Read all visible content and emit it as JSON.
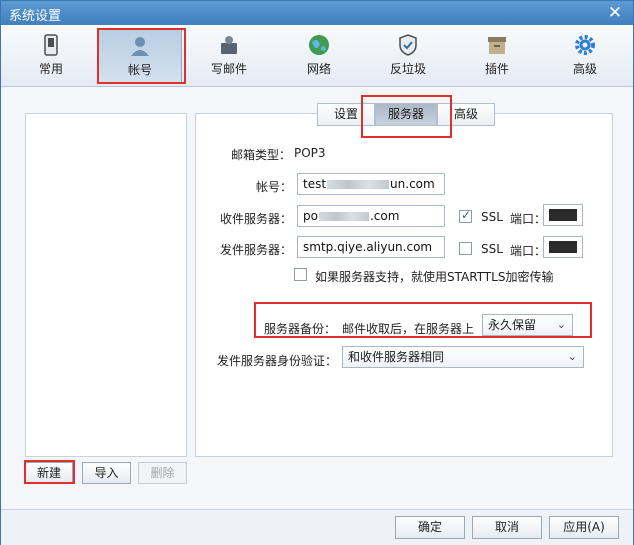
{
  "window": {
    "title": "系统设置"
  },
  "toolbar": {
    "items": [
      {
        "label": "常用",
        "icon": "phone-icon"
      },
      {
        "label": "帐号",
        "icon": "user-icon"
      },
      {
        "label": "写邮件",
        "icon": "mail-compose-icon"
      },
      {
        "label": "网络",
        "icon": "globe-icon"
      },
      {
        "label": "反垃圾",
        "icon": "shield-icon"
      },
      {
        "label": "插件",
        "icon": "box-icon"
      },
      {
        "label": "高级",
        "icon": "gear-icon"
      }
    ],
    "active_index": 1
  },
  "account_list": {
    "new_label": "新建",
    "import_label": "导入",
    "delete_label": "删除"
  },
  "tabs": [
    {
      "label": "设置"
    },
    {
      "label": "服务器"
    },
    {
      "label": "高级"
    }
  ],
  "server": {
    "mail_type_label": "邮箱类型：",
    "mail_type_value": "POP3",
    "account_label": "帐号：",
    "account_prefix": "test",
    "account_suffix": "un.com",
    "incoming_label": "收件服务器：",
    "incoming_prefix": "po",
    "incoming_suffix": ".com",
    "outgoing_label": "发件服务器：",
    "outgoing_value": "smtp.qiye.aliyun.com",
    "ssl_label": "SSL",
    "port_label": "端口：",
    "incoming_ssl_checked": true,
    "outgoing_ssl_checked": false,
    "starttls_label": "如果服务器支持，就使用STARTTLS加密传输",
    "backup_label": "服务器备份：",
    "backup_desc": "邮件收取后，在服务器上",
    "backup_value": "永久保留",
    "auth_label": "发件服务器身份验证：",
    "auth_value": "和收件服务器相同"
  },
  "footer": {
    "ok_label": "确定",
    "cancel_label": "取消",
    "apply_label": "应用(A)"
  },
  "colors": {
    "highlight_box": "#e0302c",
    "title_bar": "#3f7fbf"
  }
}
